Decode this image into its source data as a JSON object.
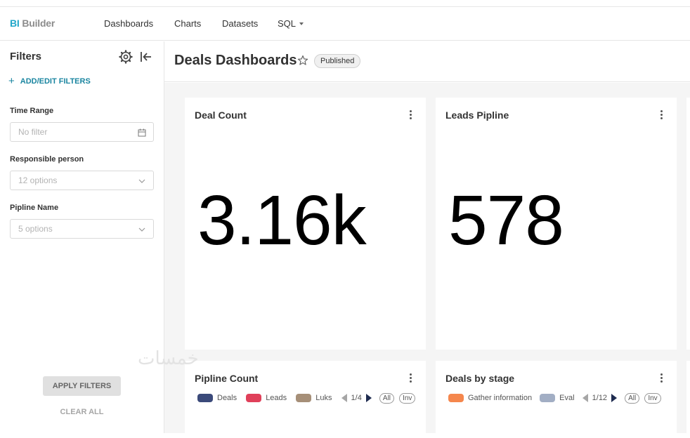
{
  "brand": {
    "bi": "BI",
    "builder": "Builder"
  },
  "nav": {
    "dashboards": "Dashboards",
    "charts": "Charts",
    "datasets": "Datasets",
    "sql": "SQL"
  },
  "sidebar": {
    "title": "Filters",
    "add_edit": "ADD/EDIT FILTERS",
    "filters": [
      {
        "label": "Time Range",
        "placeholder": "No filter"
      },
      {
        "label": "Responsible person",
        "placeholder": "12 options"
      },
      {
        "label": "Pipline Name",
        "placeholder": "5 options"
      }
    ],
    "apply": "APPLY FILTERS",
    "clear": "CLEAR ALL"
  },
  "header": {
    "title": "Deals Dashboards",
    "status": "Published"
  },
  "cards": {
    "deal_count": {
      "title": "Deal Count",
      "value": "3.16k"
    },
    "leads_pipline": {
      "title": "Leads Pipline",
      "value": "578"
    },
    "pipline_count": {
      "title": "Pipline Count",
      "legend": [
        {
          "label": "Deals",
          "color": "#3b4a7a"
        },
        {
          "label": "Leads",
          "color": "#e0405a"
        },
        {
          "label": "Luks",
          "color": "#a68f78"
        }
      ],
      "page": "1/4",
      "all": "All",
      "inv": "Inv"
    },
    "deals_by_stage": {
      "title": "Deals by stage",
      "legend": [
        {
          "label": "Gather information",
          "color": "#f5874d"
        },
        {
          "label": "Eval",
          "color": "#a2aec4"
        }
      ],
      "page": "1/12",
      "all": "All",
      "inv": "Inv"
    }
  },
  "watermark": "خمسات"
}
